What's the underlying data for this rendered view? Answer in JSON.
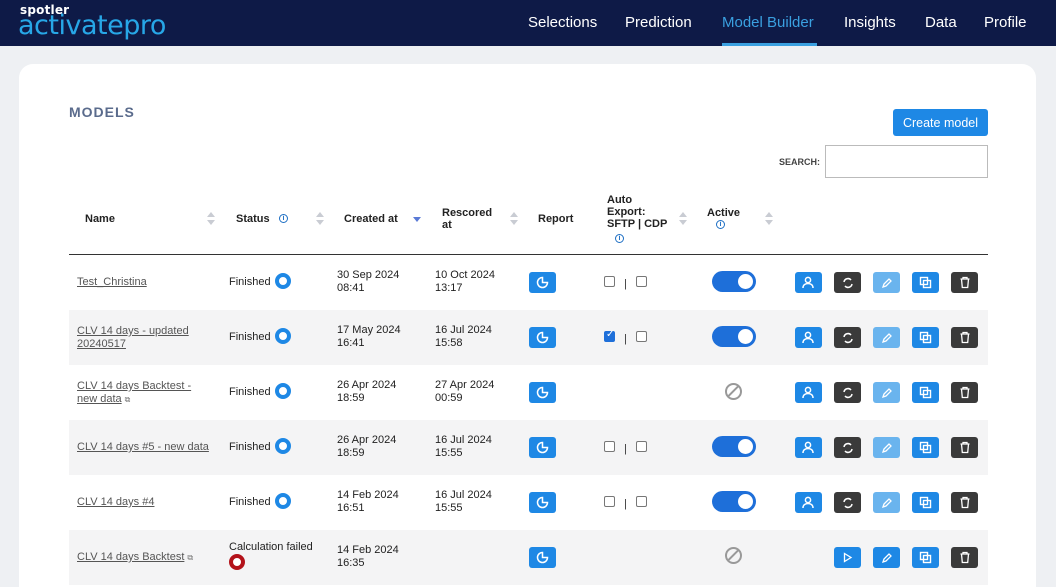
{
  "brand": {
    "small": "spotler",
    "big": "activatepro"
  },
  "nav": {
    "items": [
      {
        "label": "Selections"
      },
      {
        "label": "Prediction"
      },
      {
        "label": "Model Builder",
        "active": true
      },
      {
        "label": "Insights"
      },
      {
        "label": "Data"
      },
      {
        "label": "Profile"
      }
    ]
  },
  "page": {
    "title": "MODELS",
    "create_label": "Create model",
    "search_label": "SEARCH:",
    "search_value": ""
  },
  "table": {
    "headers": {
      "name": "Name",
      "status": "Status",
      "created": "Created at",
      "rescored": "Rescored at",
      "report": "Report",
      "export": "Auto Export: SFTP | CDP",
      "active": "Active"
    },
    "rows": [
      {
        "name": "Test_Christina",
        "status": "Finished",
        "created": "30 Sep 2024 08:41",
        "rescored": "10 Oct 2024 13:17",
        "sftp": false,
        "cdp": false,
        "active": true
      },
      {
        "name": "CLV 14 days - updated 20240517",
        "status": "Finished",
        "created": "17 May 2024 16:41",
        "rescored": "16 Jul 2024 15:58",
        "sftp": true,
        "cdp": false,
        "active": true
      },
      {
        "name": "CLV 14 days Backtest - new data",
        "status": "Finished",
        "created": "26 Apr 2024 18:59",
        "rescored": "27 Apr 2024 00:59",
        "active": null,
        "backtest": true
      },
      {
        "name": "CLV 14 days #5 - new data",
        "status": "Finished",
        "created": "26 Apr 2024 18:59",
        "rescored": "16 Jul 2024 15:55",
        "sftp": false,
        "cdp": false,
        "active": true
      },
      {
        "name": "CLV 14 days #4",
        "status": "Finished",
        "created": "14 Feb 2024 16:51",
        "rescored": "16 Jul 2024 15:55",
        "sftp": false,
        "cdp": false,
        "active": true
      },
      {
        "name": "CLV 14 days Backtest",
        "status": "Calculation failed",
        "created": "14 Feb 2024 16:35",
        "rescored": "",
        "active": null,
        "backtest": true,
        "failed": true
      }
    ]
  },
  "colors": {
    "nav_bg": "#0e1a47",
    "brand_accent": "#27a7e7",
    "primary": "#1e88e5",
    "failed": "#b3121a"
  }
}
